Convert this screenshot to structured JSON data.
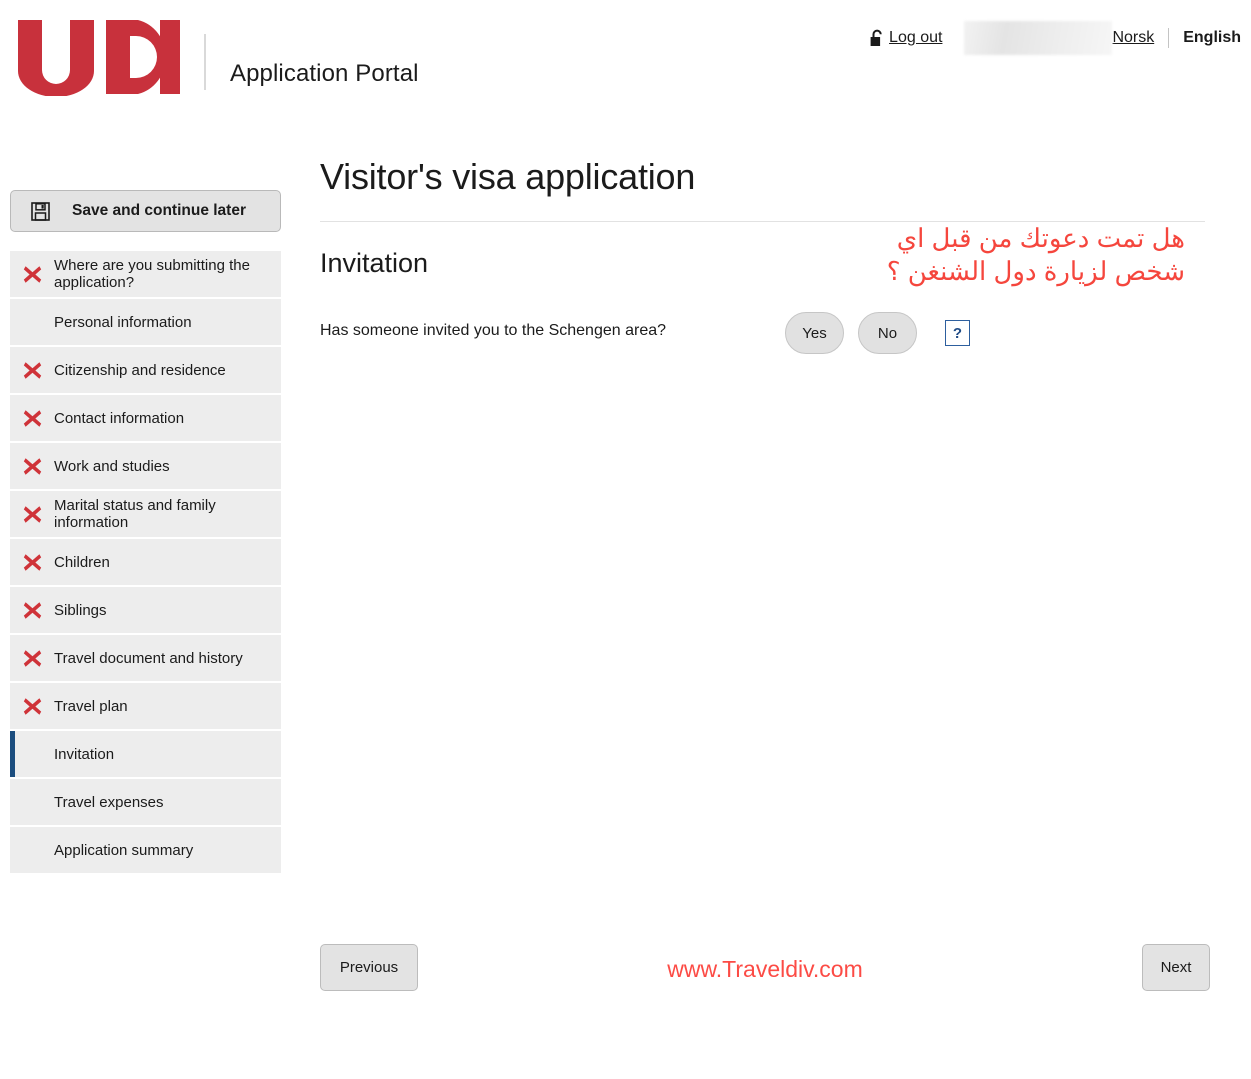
{
  "header": {
    "logo_text": "UDI",
    "logo_color": "#c8313c",
    "portal_title": "Application Portal",
    "logout_label": "Log out",
    "lock_icon": "open-padlock-icon",
    "redacted_user": "",
    "lang_norsk": "Norsk",
    "lang_english": "English"
  },
  "sidebar": {
    "save_label": "Save and continue later",
    "save_icon": "floppy-disk-icon",
    "items": [
      {
        "label": "Where are you submitting the application?",
        "incomplete": true,
        "active": false
      },
      {
        "label": "Personal information",
        "incomplete": false,
        "active": false
      },
      {
        "label": "Citizenship and residence",
        "incomplete": true,
        "active": false
      },
      {
        "label": "Contact information",
        "incomplete": true,
        "active": false
      },
      {
        "label": "Work and studies",
        "incomplete": true,
        "active": false
      },
      {
        "label": "Marital status and family information",
        "incomplete": true,
        "active": false
      },
      {
        "label": "Children",
        "incomplete": true,
        "active": false
      },
      {
        "label": "Siblings",
        "incomplete": true,
        "active": false
      },
      {
        "label": "Travel document and history",
        "incomplete": true,
        "active": false
      },
      {
        "label": "Travel plan",
        "incomplete": true,
        "active": false
      },
      {
        "label": "Invitation",
        "incomplete": false,
        "active": true
      },
      {
        "label": "Travel expenses",
        "incomplete": false,
        "active": false
      },
      {
        "label": "Application summary",
        "incomplete": false,
        "active": false
      }
    ]
  },
  "main": {
    "page_title": "Visitor's visa application",
    "section_title": "Invitation",
    "arabic_note": "هل تمت دعوتك من قبل اي\nشخص لزيارة دول الشنغن ؟",
    "question": "Has someone invited you to the Schengen area?",
    "answer_yes": "Yes",
    "answer_no": "No",
    "help_label": "?",
    "previous_label": "Previous",
    "next_label": "Next",
    "watermark": "www.Traveldiv.com"
  },
  "colors": {
    "brand_red": "#c8313c",
    "accent_red": "#f5463d",
    "active_blue": "#1b4d7e",
    "help_blue": "#1f4b86",
    "panel_grey": "#ededed"
  }
}
